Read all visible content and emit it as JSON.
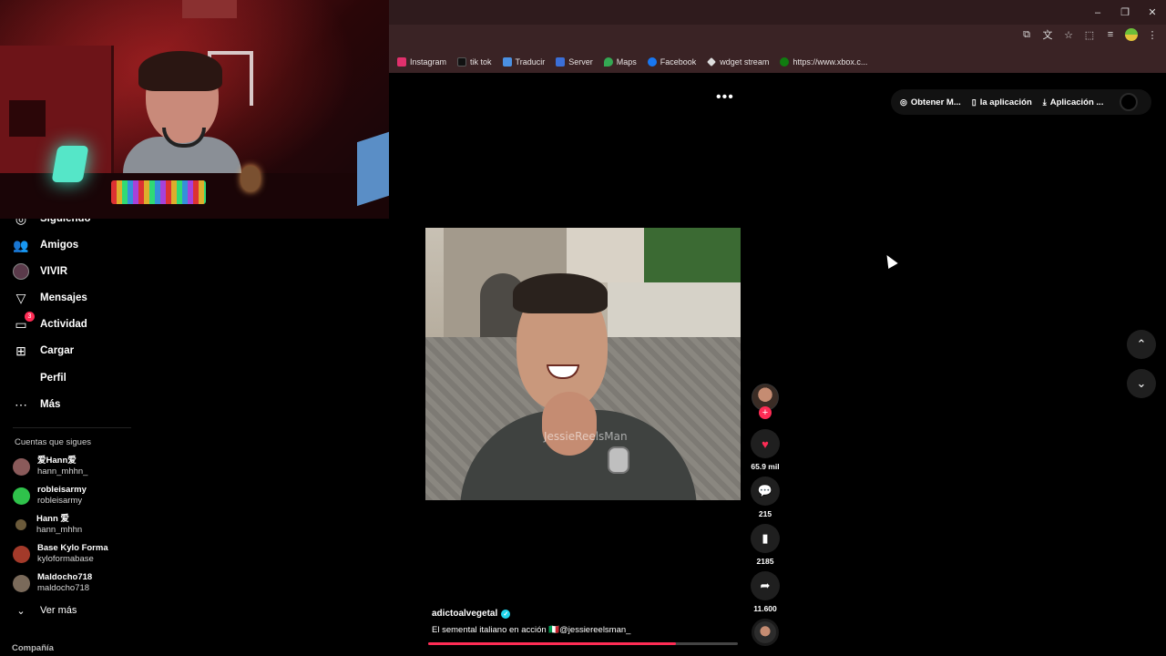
{
  "bookmarks": [
    {
      "label": "Instagram",
      "icon": "instagram-icon",
      "color": "#e1306c"
    },
    {
      "label": "tik tok",
      "icon": "tiktok-icon",
      "color": "#111111"
    },
    {
      "label": "Traducir",
      "icon": "translate-icon",
      "color": "#4a90e2"
    },
    {
      "label": "Server",
      "icon": "server-icon",
      "color": "#3b6fd8"
    },
    {
      "label": "Maps",
      "icon": "maps-icon",
      "color": "#34a853"
    },
    {
      "label": "Facebook",
      "icon": "facebook-icon",
      "color": "#1877f2"
    },
    {
      "label": "wdget stream",
      "icon": "widget-icon",
      "color": "#dddddd"
    },
    {
      "label": "https://www.xbox.c...",
      "icon": "xbox-icon",
      "color": "#107c10"
    }
  ],
  "window_controls": {
    "minimize": "–",
    "restore": "❐",
    "close": "✕"
  },
  "sidebar": {
    "items": [
      {
        "label": "Siguiendo",
        "icon": "following-icon"
      },
      {
        "label": "Amigos",
        "icon": "friends-icon"
      },
      {
        "label": "VIVIR",
        "icon": "live-icon"
      },
      {
        "label": "Mensajes",
        "icon": "messages-icon"
      },
      {
        "label": "Actividad",
        "icon": "activity-icon",
        "badge": "3"
      },
      {
        "label": "Cargar",
        "icon": "upload-icon"
      },
      {
        "label": "Perfil",
        "icon": "profile-icon"
      },
      {
        "label": "Más",
        "icon": "more-icon"
      }
    ],
    "following_title": "Cuentas que sigues",
    "accounts": [
      {
        "name": "爱Hann爱",
        "handle": "hann_mhhn_",
        "color": "#8a5a5a"
      },
      {
        "name": "robleisarmy",
        "handle": "robleisarmy",
        "color": "#2fc24b"
      },
      {
        "name": "Hann 爱",
        "handle": "hann_mhhn",
        "color": "#6b5a3a"
      },
      {
        "name": "Base Kylo Forma",
        "handle": "kyloformabase",
        "color": "#a33a2a"
      },
      {
        "name": "Maldocho718",
        "handle": "maldocho718",
        "color": "#7a6a5a"
      }
    ],
    "see_more": "Ver más",
    "company": "Compañía"
  },
  "top_actions": [
    {
      "label": "Obtener M...",
      "icon": "coin-icon"
    },
    {
      "label": "la aplicación",
      "icon": "phone-icon"
    },
    {
      "label": "Aplicación ...",
      "icon": "download-icon"
    }
  ],
  "video": {
    "watermark": "JessieReelsMan",
    "author": "adictoalvegetal",
    "caption": "El semental italiano en acción 🇮🇹@jessiereelsman_",
    "progress": 0.8
  },
  "rail": {
    "likes": "65.9 mil",
    "comments": "215",
    "saves": "2185",
    "shares": "11.600"
  },
  "colors": {
    "accent": "#fe2c55",
    "verified": "#20d5ec"
  }
}
